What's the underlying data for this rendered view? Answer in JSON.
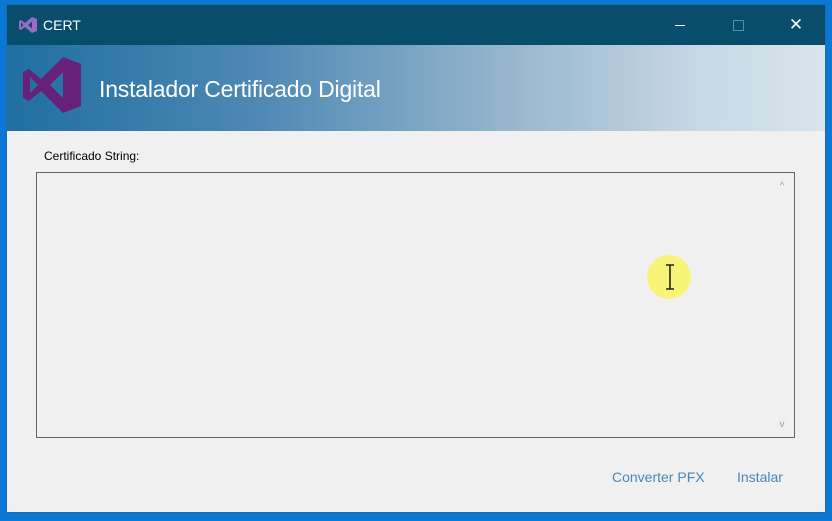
{
  "window": {
    "title": "CERT",
    "controls": {
      "minimize_icon": "minimize-icon",
      "maximize_icon": "maximize-icon",
      "close_glyph": "✕"
    }
  },
  "banner": {
    "title": "Instalador Certificado Digital",
    "logo_icon": "visual-studio-logo-icon"
  },
  "form": {
    "field_label": "Certificado String:",
    "field_value": "",
    "scroll_up_glyph": "^",
    "scroll_down_glyph": "v"
  },
  "actions": {
    "converter_label": "Converter PFX",
    "instalar_label": "Instalar"
  },
  "colors": {
    "titlebar": "#084d6b",
    "accent": "#0a78d4",
    "link_button": "#4a86b8",
    "logo_purple": "#68217a",
    "cursor_highlight": "#faf550"
  }
}
